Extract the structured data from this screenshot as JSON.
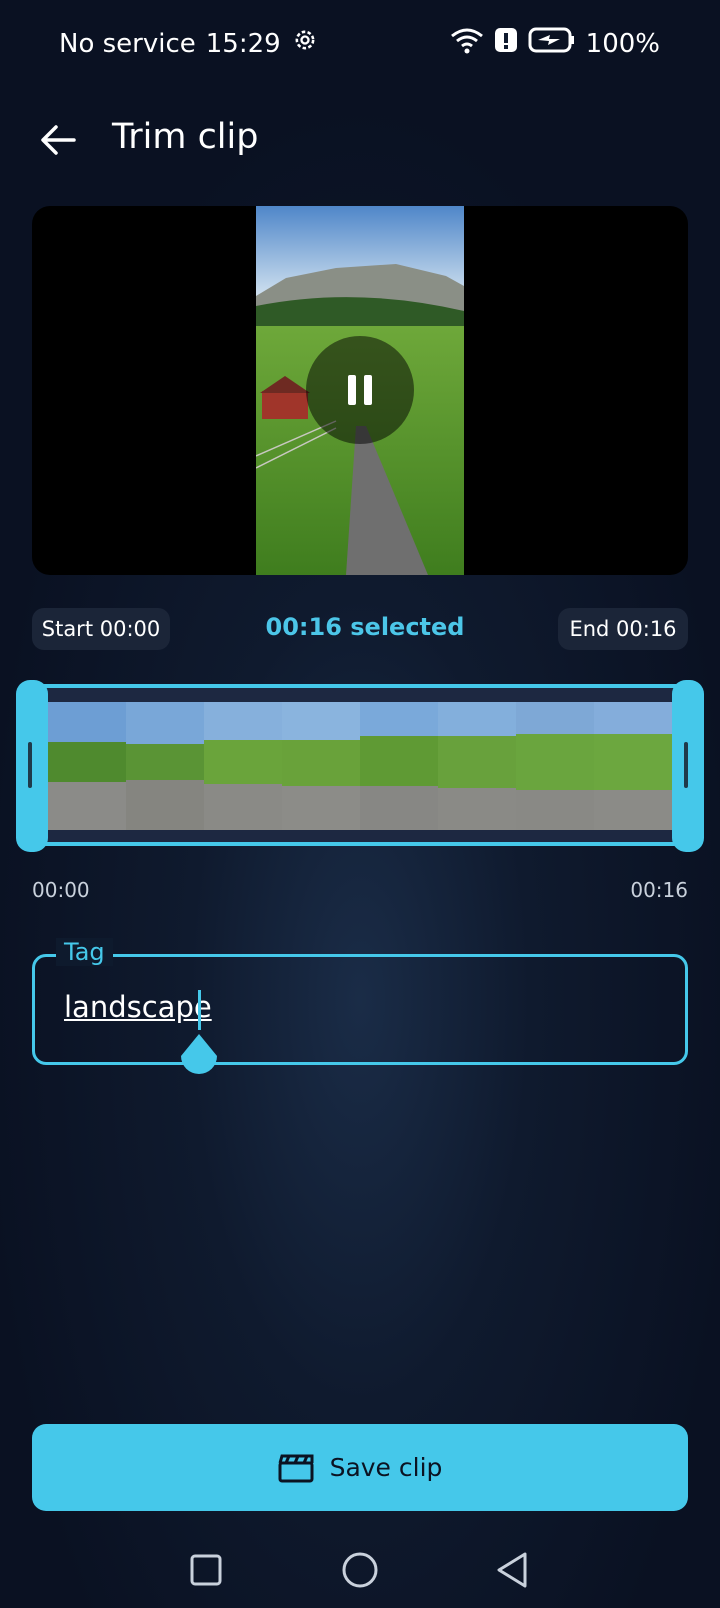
{
  "status_bar": {
    "carrier": "No service",
    "time": "15:29",
    "battery": "100%"
  },
  "app_bar": {
    "title": "Trim clip"
  },
  "trim_info": {
    "start": "Start 00:00",
    "selected": "00:16 selected",
    "end": "End 00:16"
  },
  "timeline": {
    "start_time": "00:00",
    "end_time": "00:16"
  },
  "tag_field": {
    "label": "Tag",
    "value": "landscape"
  },
  "save_button": {
    "label": "Save clip"
  },
  "colors": {
    "accent": "#45c8ea",
    "background": "#0f1a2e"
  }
}
